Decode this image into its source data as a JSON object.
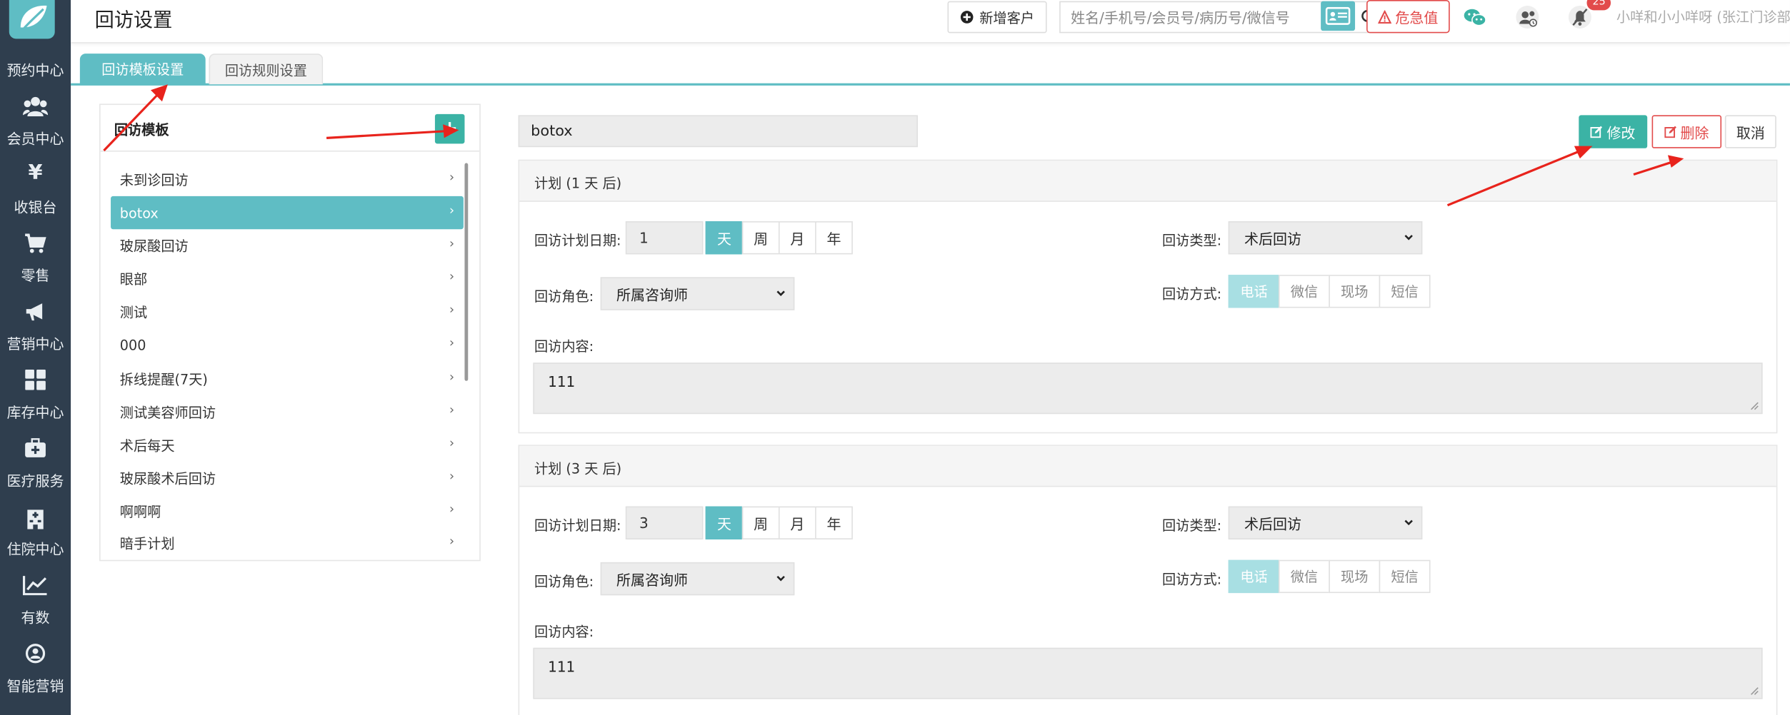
{
  "sidebar": {
    "partial_top_label": "预约中心",
    "items": [
      {
        "label": "会员中心",
        "icon": "members-icon"
      },
      {
        "label": "收银台",
        "icon": "yen-icon"
      },
      {
        "label": "零售",
        "icon": "cart-icon"
      },
      {
        "label": "营销中心",
        "icon": "megaphone-icon"
      },
      {
        "label": "库存中心",
        "icon": "grid-icon"
      },
      {
        "label": "医疗服务",
        "icon": "medkit-icon"
      },
      {
        "label": "住院中心",
        "icon": "hospital-icon"
      },
      {
        "label": "有数",
        "icon": "chart-line-icon"
      },
      {
        "label": "智能营销",
        "icon": "smart-marketing-icon"
      }
    ]
  },
  "header": {
    "title": "回访设置",
    "new_customer_label": "新增客户",
    "search_placeholder": "姓名/手机号/会员号/病历号/微信号",
    "critical_label": "危急值",
    "notification_count": "25",
    "user_label": "小咩和小小咩呀 (张江门诊部)"
  },
  "tabs": [
    {
      "label": "回访模板设置",
      "active": true
    },
    {
      "label": "回访规则设置",
      "active": false
    }
  ],
  "templates": {
    "title": "回访模板",
    "items": [
      "未到诊回访",
      "botox",
      "玻尿酸回访",
      "眼部",
      "测试",
      "000",
      "拆线提醒(7天)",
      "测试美容师回访",
      "术后每天",
      "玻尿酸术后回访",
      "啊啊啊",
      "暗手计划"
    ],
    "selected_index": 1
  },
  "editor": {
    "template_name": "botox",
    "edit_label": "修改",
    "delete_label": "删除",
    "cancel_label": "取消",
    "labels": {
      "plan_date": "回访计划日期:",
      "type": "回访类型:",
      "role": "回访角色:",
      "method": "回访方式:",
      "content": "回访内容:"
    },
    "units": [
      "天",
      "周",
      "月",
      "年"
    ],
    "methods": [
      "电话",
      "微信",
      "现场",
      "短信"
    ],
    "plans": [
      {
        "title": "计划  (1 天 后)",
        "days": "1",
        "unit_selected": 0,
        "type": "术后回访",
        "role": "所属咨询师",
        "method_selected": 0,
        "content": "111"
      },
      {
        "title": "计划  (3 天 后)",
        "days": "3",
        "unit_selected": 0,
        "type": "术后回访",
        "role": "所属咨询师",
        "method_selected": 0,
        "content": "111"
      }
    ]
  },
  "colors": {
    "sidebar_bg": "#2f3e4e",
    "accent": "#5fbdc4",
    "primary_button": "#3bb3a5",
    "danger": "#e24b4b",
    "annotation_arrow": "#e8231c"
  }
}
